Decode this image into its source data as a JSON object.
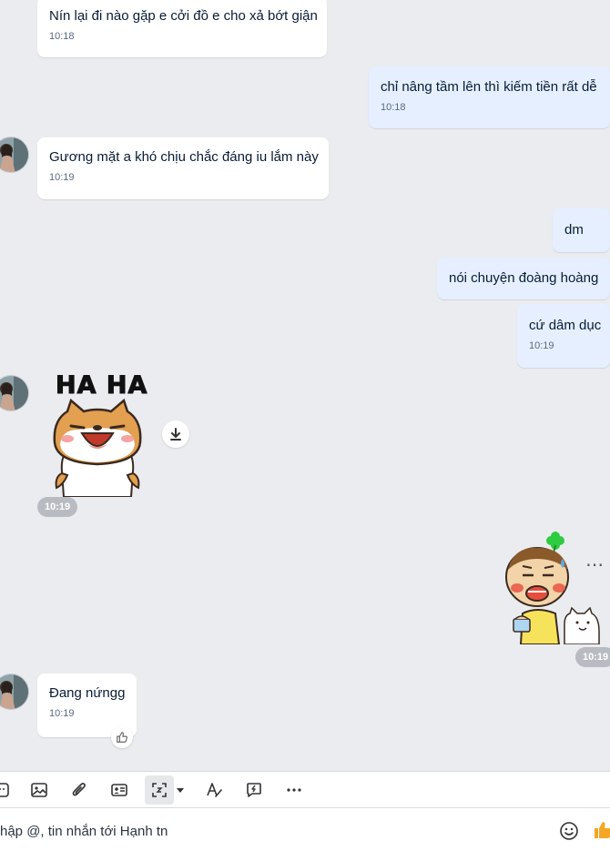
{
  "messages": [
    {
      "id": "m1",
      "sender": "other",
      "text": "Nín lại đi nào gặp e cởi đồ e cho xả bớt giận",
      "time": "10:18"
    },
    {
      "id": "m2",
      "sender": "me",
      "text": "chỉ nâng tầm lên thì kiếm tiền rất dễ",
      "time": "10:18"
    },
    {
      "id": "m3",
      "sender": "other",
      "text": "Gương mặt a khó chịu chắc đáng iu lắm này",
      "time": "10:19"
    },
    {
      "id": "m4",
      "sender": "me",
      "text": "dm"
    },
    {
      "id": "m5",
      "sender": "me",
      "text": "nói chuyện đoàng hoàng"
    },
    {
      "id": "m6",
      "sender": "me",
      "text": "cứ dâm dục",
      "time": "10:19"
    },
    {
      "id": "m7",
      "sender": "other",
      "type": "sticker",
      "sticker_text": "HA HA",
      "time": "10:19"
    },
    {
      "id": "m8",
      "sender": "me",
      "type": "sticker",
      "time": "10:19"
    },
    {
      "id": "m9",
      "sender": "other",
      "text": "Đang nứngg",
      "time": "10:19",
      "reaction": "like-icon"
    }
  ],
  "toolbar": {
    "icons": [
      "sticker-icon",
      "image-icon",
      "attachment-icon",
      "contact-card-icon",
      "screenshot-icon",
      "dropdown-arrow-icon",
      "text-format-icon",
      "quick-message-icon",
      "more-icon"
    ]
  },
  "composer": {
    "placeholder": "hập @, tin nhắn tới Hạnh tn",
    "icons": [
      "emoji-icon",
      "like-icon"
    ]
  },
  "colors": {
    "chat_background": "#ebecf0",
    "my_bubble": "#e5efff",
    "their_bubble": "#ffffff",
    "accent_like": "#f5a623"
  }
}
